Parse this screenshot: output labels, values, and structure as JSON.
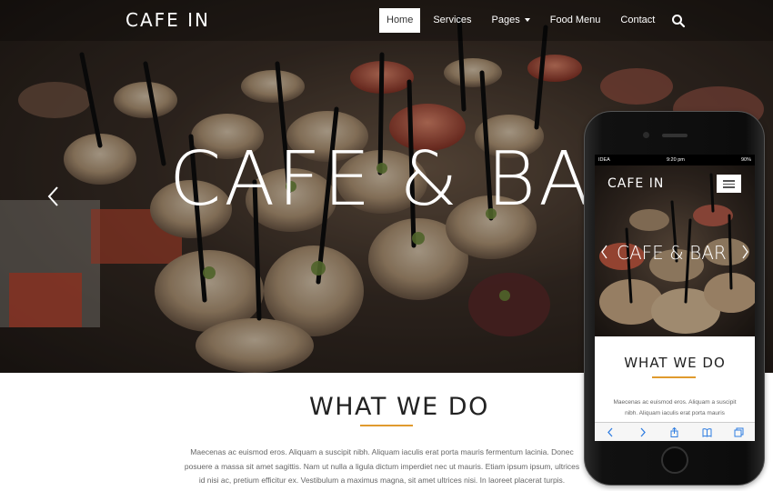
{
  "header": {
    "brand": "CAFE IN",
    "nav": [
      {
        "label": "Home",
        "active": true
      },
      {
        "label": "Services",
        "active": false
      },
      {
        "label": "Pages",
        "active": false,
        "dropdown": true
      },
      {
        "label": "Food Menu",
        "active": false
      },
      {
        "label": "Contact",
        "active": false
      }
    ],
    "search_icon": "search-icon"
  },
  "hero": {
    "title": "CAFE & BAR",
    "prev_icon": "chevron-left-icon"
  },
  "section": {
    "title": "WHAT WE DO",
    "lines": [
      "Maecenas ac euismod eros. Aliquam a suscipit nibh. Aliquam iaculis erat porta mauris fermentum lacinia. Donec",
      "posuere a massa sit amet sagittis. Nam ut nulla a ligula dictum imperdiet nec ut mauris. Etiam ipsum ipsum, ultrices",
      "id nisi ac, pretium efficitur ex. Vestibulum a maximus magna, sit amet ultrices nisi. In laoreet placerat turpis."
    ]
  },
  "phone": {
    "status": {
      "carrier": "IDEA",
      "time": "9:20 pm",
      "battery": "90%"
    },
    "brand": "CAFE IN",
    "menu_icon": "hamburger-icon",
    "hero_title": "CAFE & BAR",
    "section_title": "WHAT WE DO",
    "lines": [
      "Maecenas ac euismod eros. Aliquam a suscipit",
      "nibh. Aliquam iaculis erat porta mauris"
    ],
    "toolbar_icons": [
      "back-icon",
      "forward-icon",
      "share-icon",
      "bookmarks-icon",
      "tabs-icon"
    ]
  },
  "colors": {
    "accent": "#e09a2e",
    "active_nav_bg": "#ffffff",
    "text": "#222222",
    "muted": "#666666"
  }
}
